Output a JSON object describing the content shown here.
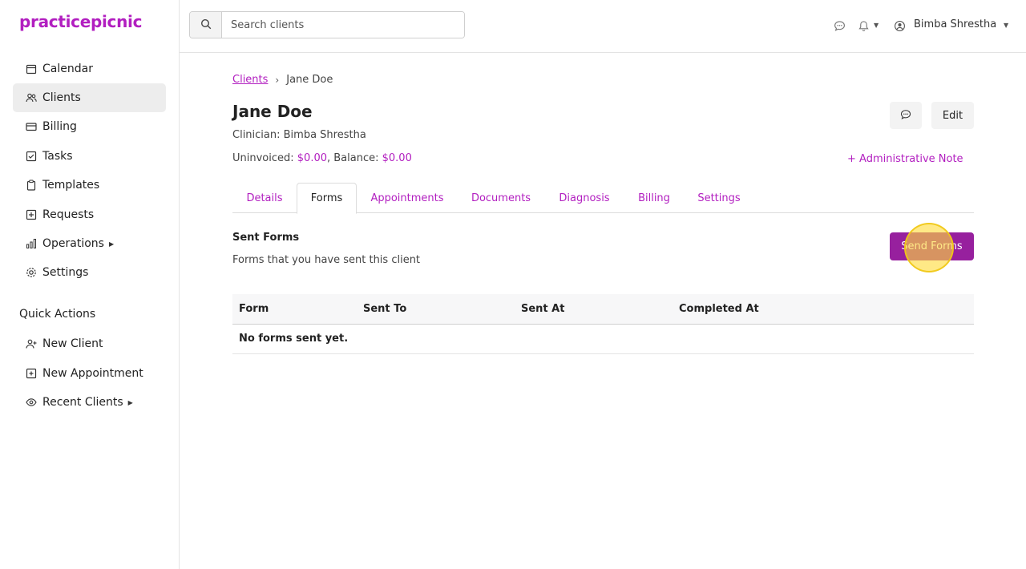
{
  "brand": {
    "logo": "practicepicnic",
    "accent": "#b21fc0",
    "button": "#97209e"
  },
  "sidebar": {
    "items": [
      {
        "label": "Calendar",
        "icon": "calendar-icon"
      },
      {
        "label": "Clients",
        "icon": "users-icon",
        "active": true
      },
      {
        "label": "Billing",
        "icon": "credit-card-icon"
      },
      {
        "label": "Tasks",
        "icon": "checkbox-icon"
      },
      {
        "label": "Templates",
        "icon": "clipboard-icon"
      },
      {
        "label": "Requests",
        "icon": "plus-square-icon"
      },
      {
        "label": "Operations",
        "icon": "bar-chart-icon",
        "has_submenu": true
      },
      {
        "label": "Settings",
        "icon": "gear-icon"
      }
    ],
    "quick_actions_title": "Quick Actions",
    "quick_actions": [
      {
        "label": "New Client",
        "icon": "user-plus-icon"
      },
      {
        "label": "New Appointment",
        "icon": "calendar-plus-icon"
      },
      {
        "label": "Recent Clients",
        "icon": "eye-icon",
        "has_submenu": true
      }
    ]
  },
  "topbar": {
    "search_placeholder": "Search clients",
    "user_name": "Bimba Shrestha"
  },
  "client": {
    "breadcrumb_parent": "Clients",
    "breadcrumb_current": "Jane Doe",
    "name": "Jane Doe",
    "clinician_label": "Clinician: Bimba Shrestha",
    "uninvoiced_label": "Uninvoiced: ",
    "uninvoiced_value": "$0.00",
    "balance_label": ", Balance: ",
    "balance_value": "$0.00",
    "edit_label": "Edit",
    "admin_note_label": "+ Administrative Note"
  },
  "tabs": [
    "Details",
    "Forms",
    "Appointments",
    "Documents",
    "Diagnosis",
    "Billing",
    "Settings"
  ],
  "active_tab": "Forms",
  "forms": {
    "title": "Sent Forms",
    "description": "Forms that you have sent this client",
    "send_button": "Send Forms",
    "columns": [
      "Form",
      "Sent To",
      "Sent At",
      "Completed At"
    ],
    "empty_text": "No forms sent yet."
  }
}
